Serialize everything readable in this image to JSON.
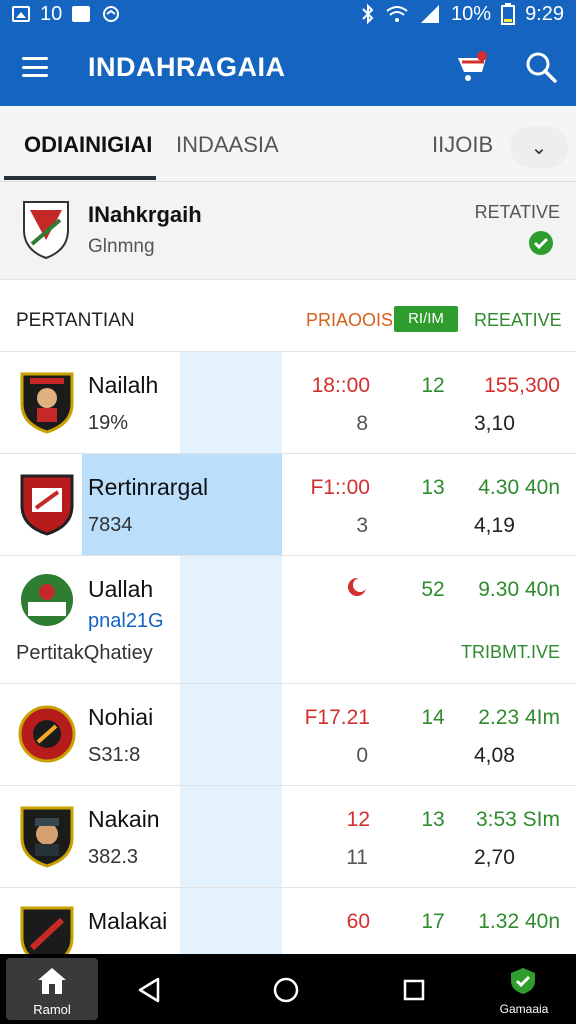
{
  "status_bar": {
    "left_time_label": "10",
    "battery_pct": "10%",
    "clock": "9:29"
  },
  "app_bar": {
    "title": "INDAHRAGAIA"
  },
  "tabs": [
    {
      "label": "ODIAINIGIAI",
      "active": true
    },
    {
      "label": "INDAASIA",
      "active": false
    },
    {
      "label": "IIJOIB",
      "active": false
    }
  ],
  "header_card": {
    "title": "INahkrgaih",
    "subtitle": "Glnmng",
    "right_label": "RETATIVE"
  },
  "section": {
    "title": "PERTANTIAN",
    "col1": "PRIAOOIS",
    "pill": "RI/IM",
    "col3": "REEATIVE"
  },
  "rows": [
    {
      "name": "Nailalh",
      "sub": "19%",
      "time": "18::00",
      "mid": "8",
      "num": "12",
      "odds": "155,300",
      "odds2": "3,10"
    },
    {
      "name": "Rertinrargal",
      "sub": "7834",
      "time": "F1::00",
      "mid": "3",
      "num": "13",
      "odds": "4.30 40n",
      "odds2": "4,19"
    },
    {
      "name": "Uallah",
      "sub": "pnal21G",
      "banner_left": "PertitakQhatiey",
      "banner_right": "TRIBMT.IVE",
      "num": "52",
      "odds": "9.30 40n"
    },
    {
      "name": "Nohiai",
      "sub": "S31:8",
      "time": "F17.21",
      "mid": "0",
      "num": "14",
      "odds": "2.23 4Im",
      "odds2": "4,08"
    },
    {
      "name": "Nakain",
      "sub": "382.3",
      "time": "12",
      "mid": "11",
      "num": "13",
      "odds": "3:53 SIm",
      "odds2": "2,70"
    },
    {
      "name": "Malakai",
      "time": "60",
      "num": "17",
      "odds": "1.32 40n"
    }
  ],
  "nav": {
    "home_label": "Ramol",
    "extra_label": "Gamaaia"
  },
  "colors": {
    "primary": "#1565c0",
    "accent_green": "#2e9d2e",
    "alert_red": "#d32f2f"
  }
}
